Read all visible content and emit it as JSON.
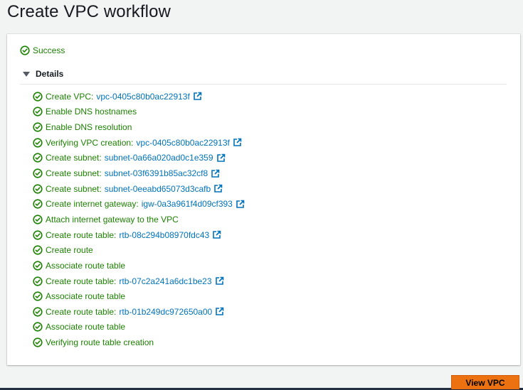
{
  "page": {
    "title": "Create VPC workflow"
  },
  "status": {
    "label": "Success"
  },
  "details": {
    "label": "Details"
  },
  "steps": [
    {
      "label": "Create VPC:",
      "link": "vpc-0405c80b0ac22913f"
    },
    {
      "label": "Enable DNS hostnames",
      "link": ""
    },
    {
      "label": "Enable DNS resolution",
      "link": ""
    },
    {
      "label": "Verifying VPC creation:",
      "link": "vpc-0405c80b0ac22913f"
    },
    {
      "label": "Create subnet:",
      "link": "subnet-0a66a020ad0c1e359"
    },
    {
      "label": "Create subnet:",
      "link": "subnet-03f6391b85ac32cf8"
    },
    {
      "label": "Create subnet:",
      "link": "subnet-0eeabd65073d3cafb"
    },
    {
      "label": "Create internet gateway:",
      "link": "igw-0a3a961f4d09cf393"
    },
    {
      "label": "Attach internet gateway to the VPC",
      "link": ""
    },
    {
      "label": "Create route table:",
      "link": "rtb-08c294b08970fdc43"
    },
    {
      "label": "Create route",
      "link": ""
    },
    {
      "label": "Associate route table",
      "link": ""
    },
    {
      "label": "Create route table:",
      "link": "rtb-07c2a241a6dc1be23"
    },
    {
      "label": "Associate route table",
      "link": ""
    },
    {
      "label": "Create route table:",
      "link": "rtb-01b249dc972650a00"
    },
    {
      "label": "Associate route table",
      "link": ""
    },
    {
      "label": "Verifying route table creation",
      "link": ""
    }
  ],
  "footer": {
    "view_vpc_label": "View VPC"
  },
  "colors": {
    "success": "#1d8102",
    "link": "#0073bb",
    "primary_button": "#ec7211",
    "footer_bar": "#232f3e"
  },
  "icons": {
    "status": "check-circle-icon",
    "toggle": "caret-down-icon",
    "external": "external-link-icon"
  }
}
